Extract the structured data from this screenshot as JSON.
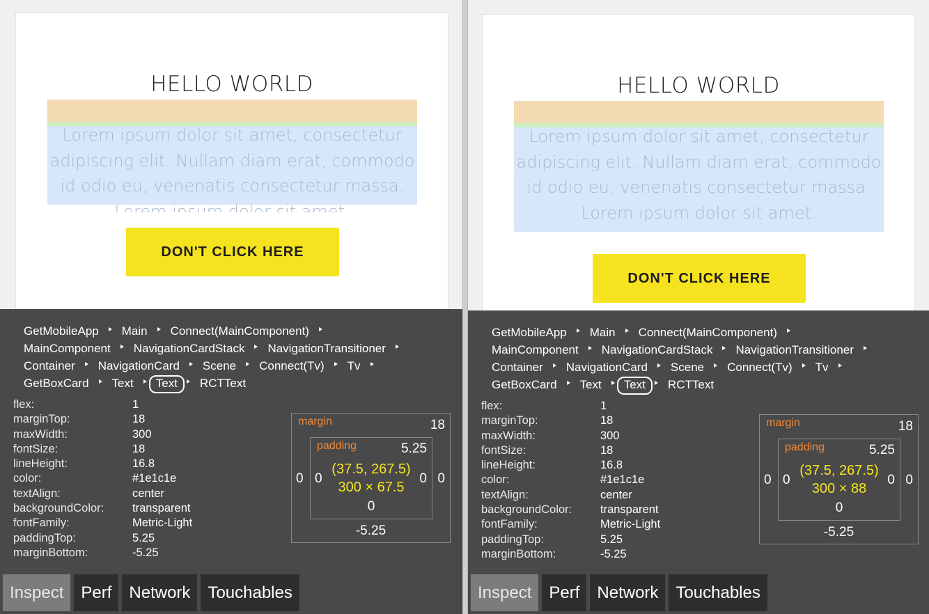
{
  "screens": [
    {
      "card": {
        "title": "HELLO WORLD",
        "body_text": "Lorem ipsum dolor sit amet, consectetur adipiscing elit. Nullam diam erat, commodo id odio eu, venenatis consectetur massa. Lorem ipsum dolor sit amet.",
        "button_label": "DON'T CLICK HERE"
      },
      "breadcrumbs": [
        [
          "GetMobileApp",
          "Main",
          "Connect(MainComponent)"
        ],
        [
          "MainComponent",
          "NavigationCardStack",
          "NavigationTransitioner"
        ],
        [
          "Container",
          "NavigationCard",
          "Scene",
          "Connect(Tv)",
          "Tv"
        ],
        [
          "GetBoxCard",
          "Text",
          "Text",
          "RCTText"
        ]
      ],
      "selected_crumb": "Text",
      "style_props": [
        {
          "key": "flex:",
          "value": "1"
        },
        {
          "key": "marginTop:",
          "value": "18"
        },
        {
          "key": "maxWidth:",
          "value": "300"
        },
        {
          "key": "fontSize:",
          "value": "18"
        },
        {
          "key": "lineHeight:",
          "value": "16.8"
        },
        {
          "key": "color:",
          "value": "#1e1c1e"
        },
        {
          "key": "textAlign:",
          "value": "center"
        },
        {
          "key": "backgroundColor:",
          "value": "transparent"
        },
        {
          "key": "fontFamily:",
          "value": "Metric-Light"
        },
        {
          "key": "paddingTop:",
          "value": "5.25"
        },
        {
          "key": "marginBottom:",
          "value": "-5.25"
        }
      ],
      "box_model": {
        "margin_label": "margin",
        "padding_label": "padding",
        "margin_top": "18",
        "margin_left": "0",
        "margin_right": "0",
        "margin_bottom": "-5.25",
        "padding_top": "5.25",
        "padding_left": "0",
        "padding_right": "0",
        "padding_bottom": "0",
        "position": "(37.5, 267.5)",
        "size": "300 × 67.5"
      },
      "tabs": [
        "Inspect",
        "Perf",
        "Network",
        "Touchables"
      ],
      "active_tab": "Inspect"
    },
    {
      "card": {
        "title": "HELLO WORLD",
        "body_text": "Lorem ipsum dolor sit amet, consectetur adipiscing elit. Nullam diam erat, commodo id odio eu, venenatis consectetur massa. Lorem ipsum dolor sit amet.",
        "button_label": "DON'T CLICK HERE"
      },
      "breadcrumbs": [
        [
          "GetMobileApp",
          "Main",
          "Connect(MainComponent)"
        ],
        [
          "MainComponent",
          "NavigationCardStack",
          "NavigationTransitioner"
        ],
        [
          "Container",
          "NavigationCard",
          "Scene",
          "Connect(Tv)",
          "Tv"
        ],
        [
          "GetBoxCard",
          "Text",
          "Text",
          "RCTText"
        ]
      ],
      "selected_crumb": "Text",
      "style_props": [
        {
          "key": "flex:",
          "value": "1"
        },
        {
          "key": "marginTop:",
          "value": "18"
        },
        {
          "key": "maxWidth:",
          "value": "300"
        },
        {
          "key": "fontSize:",
          "value": "18"
        },
        {
          "key": "lineHeight:",
          "value": "16.8"
        },
        {
          "key": "color:",
          "value": "#1e1c1e"
        },
        {
          "key": "textAlign:",
          "value": "center"
        },
        {
          "key": "backgroundColor:",
          "value": "transparent"
        },
        {
          "key": "fontFamily:",
          "value": "Metric-Light"
        },
        {
          "key": "paddingTop:",
          "value": "5.25"
        },
        {
          "key": "marginBottom:",
          "value": "-5.25"
        }
      ],
      "box_model": {
        "margin_label": "margin",
        "padding_label": "padding",
        "margin_top": "18",
        "margin_left": "0",
        "margin_right": "0",
        "margin_bottom": "-5.25",
        "padding_top": "5.25",
        "padding_left": "0",
        "padding_right": "0",
        "padding_bottom": "0",
        "position": "(37.5, 267.5)",
        "size": "300 × 88"
      },
      "tabs": [
        "Inspect",
        "Perf",
        "Network",
        "Touchables"
      ],
      "active_tab": "Inspect"
    }
  ]
}
